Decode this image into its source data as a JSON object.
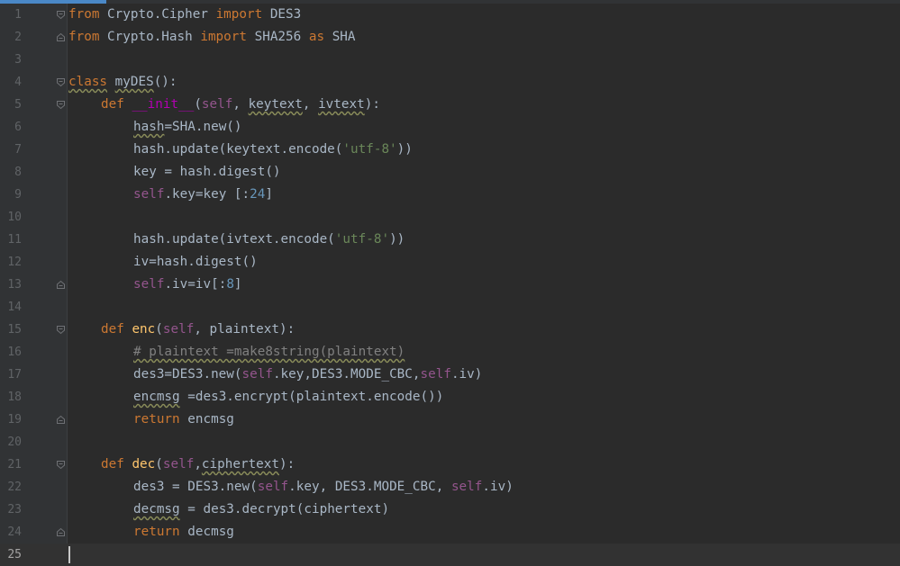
{
  "editor": {
    "current_line": 25,
    "lines": [
      {
        "n": "1",
        "indent": 0,
        "fold": "top",
        "tokens": [
          {
            "t": "from",
            "c": "kw"
          },
          {
            "t": " Crypto.Cipher "
          },
          {
            "t": "import",
            "c": "kw"
          },
          {
            "t": " DES3"
          }
        ]
      },
      {
        "n": "2",
        "indent": 0,
        "fold": "bottom",
        "tokens": [
          {
            "t": "from",
            "c": "kw"
          },
          {
            "t": " Crypto.Hash "
          },
          {
            "t": "import",
            "c": "kw"
          },
          {
            "t": " SHA256 "
          },
          {
            "t": "as",
            "c": "kw"
          },
          {
            "t": " SHA"
          }
        ]
      },
      {
        "n": "3",
        "indent": 0,
        "tokens": []
      },
      {
        "n": "4",
        "indent": 0,
        "fold": "top",
        "tokens": [
          {
            "t": "class",
            "c": "kw wavy"
          },
          {
            "t": " "
          },
          {
            "t": "myDES",
            "c": "wavy"
          },
          {
            "t": "():"
          }
        ]
      },
      {
        "n": "5",
        "indent": 1,
        "fold": "top",
        "tokens": [
          {
            "t": "def",
            "c": "kw"
          },
          {
            "t": " "
          },
          {
            "t": "__init__",
            "c": "dun"
          },
          {
            "t": "("
          },
          {
            "t": "self",
            "c": "sf"
          },
          {
            "t": ", "
          },
          {
            "t": "keytext",
            "c": "wavy"
          },
          {
            "t": ", "
          },
          {
            "t": "ivtext",
            "c": "wavy"
          },
          {
            "t": "):"
          }
        ]
      },
      {
        "n": "6",
        "indent": 2,
        "tokens": [
          {
            "t": "hash",
            "c": "wavy"
          },
          {
            "t": "=SHA.new()"
          }
        ]
      },
      {
        "n": "7",
        "indent": 2,
        "tokens": [
          {
            "t": "hash.update(keytext.encode("
          },
          {
            "t": "'utf-8'",
            "c": "str"
          },
          {
            "t": "))"
          }
        ]
      },
      {
        "n": "8",
        "indent": 2,
        "tokens": [
          {
            "t": "key = hash.digest()"
          }
        ]
      },
      {
        "n": "9",
        "indent": 2,
        "tokens": [
          {
            "t": "self",
            "c": "sf"
          },
          {
            "t": ".key=key "
          },
          {
            "t": "[:",
            "c": ""
          },
          {
            "t": "24",
            "c": "num"
          },
          {
            "t": "]"
          }
        ]
      },
      {
        "n": "10",
        "indent": 0,
        "tokens": []
      },
      {
        "n": "11",
        "indent": 2,
        "tokens": [
          {
            "t": "hash.update(ivtext.encode("
          },
          {
            "t": "'utf-8'",
            "c": "str"
          },
          {
            "t": "))"
          }
        ]
      },
      {
        "n": "12",
        "indent": 2,
        "tokens": [
          {
            "t": "iv=hash.digest()"
          }
        ]
      },
      {
        "n": "13",
        "indent": 2,
        "fold": "bottom",
        "tokens": [
          {
            "t": "self",
            "c": "sf"
          },
          {
            "t": ".iv=iv[:"
          },
          {
            "t": "8",
            "c": "num"
          },
          {
            "t": "]"
          }
        ]
      },
      {
        "n": "14",
        "indent": 0,
        "tokens": []
      },
      {
        "n": "15",
        "indent": 1,
        "fold": "top",
        "tokens": [
          {
            "t": "def",
            "c": "kw"
          },
          {
            "t": " "
          },
          {
            "t": "enc",
            "c": "fn"
          },
          {
            "t": "("
          },
          {
            "t": "self",
            "c": "sf"
          },
          {
            "t": ", plaintext):"
          }
        ]
      },
      {
        "n": "16",
        "indent": 2,
        "tokens": [
          {
            "t": "# plaintext =make8string(plaintext)",
            "c": "cmt wavy"
          }
        ]
      },
      {
        "n": "17",
        "indent": 2,
        "tokens": [
          {
            "t": "des3=DES3.new("
          },
          {
            "t": "self",
            "c": "sf"
          },
          {
            "t": ".key,DES3.MODE_CBC,"
          },
          {
            "t": "self",
            "c": "sf"
          },
          {
            "t": ".iv)"
          }
        ]
      },
      {
        "n": "18",
        "indent": 2,
        "tokens": [
          {
            "t": "encmsg",
            "c": "wavy"
          },
          {
            "t": " =des3.encrypt(plaintext.encode())"
          }
        ]
      },
      {
        "n": "19",
        "indent": 2,
        "fold": "bottom",
        "tokens": [
          {
            "t": "return",
            "c": "kw"
          },
          {
            "t": " encmsg"
          }
        ]
      },
      {
        "n": "20",
        "indent": 0,
        "tokens": []
      },
      {
        "n": "21",
        "indent": 1,
        "fold": "top",
        "tokens": [
          {
            "t": "def",
            "c": "kw"
          },
          {
            "t": " "
          },
          {
            "t": "dec",
            "c": "fn"
          },
          {
            "t": "("
          },
          {
            "t": "self",
            "c": "sf"
          },
          {
            "t": ","
          },
          {
            "t": "ciphertext",
            "c": "wavy"
          },
          {
            "t": "):"
          }
        ]
      },
      {
        "n": "22",
        "indent": 2,
        "tokens": [
          {
            "t": "des3 = DES3.new("
          },
          {
            "t": "self",
            "c": "sf"
          },
          {
            "t": ".key, DES3.MODE_CBC, "
          },
          {
            "t": "self",
            "c": "sf"
          },
          {
            "t": ".iv)"
          }
        ]
      },
      {
        "n": "23",
        "indent": 2,
        "tokens": [
          {
            "t": "decmsg",
            "c": "wavy"
          },
          {
            "t": " = des3.decrypt(ciphertext)"
          }
        ]
      },
      {
        "n": "24",
        "indent": 2,
        "fold": "bottom",
        "tokens": [
          {
            "t": "return",
            "c": "kw"
          },
          {
            "t": " decmsg"
          }
        ]
      },
      {
        "n": "25",
        "indent": 0,
        "tokens": []
      }
    ]
  }
}
